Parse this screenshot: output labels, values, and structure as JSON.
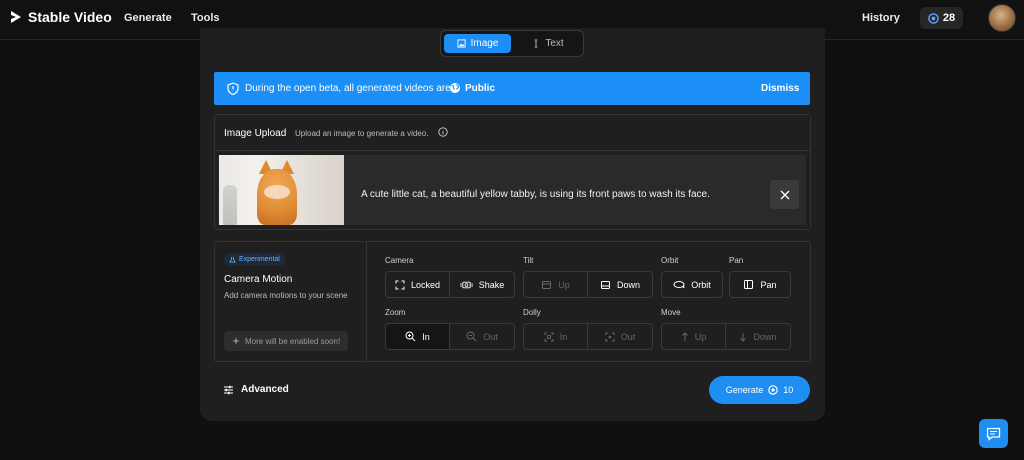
{
  "nav": {
    "brand": "Stable Video",
    "items": [
      "Generate",
      "Tools"
    ],
    "history": "History",
    "credits": "28"
  },
  "mode": {
    "image": "Image",
    "text": "Text"
  },
  "banner": {
    "text": "During the open beta, all generated videos are",
    "visibility": "Public",
    "dismiss": "Dismiss"
  },
  "upload": {
    "title": "Image Upload",
    "subtitle": "Upload an image to generate a video.",
    "caption": "A cute little cat, a beautiful yellow tabby, is using its front paws to wash its face."
  },
  "motion": {
    "badge": "Experimental",
    "title": "Camera Motion",
    "subtitle": "Add camera motions to your scene",
    "soon": "More will be enabled soon!",
    "groups": {
      "camera": {
        "label": "Camera",
        "a": "Locked",
        "b": "Shake"
      },
      "tilt": {
        "label": "Tilt",
        "a": "Up",
        "b": "Down"
      },
      "orbit": {
        "label": "Orbit",
        "a": "Orbit"
      },
      "pan": {
        "label": "Pan",
        "a": "Pan"
      },
      "zoom": {
        "label": "Zoom",
        "a": "In",
        "b": "Out"
      },
      "dolly": {
        "label": "Dolly",
        "a": "In",
        "b": "Out"
      },
      "move": {
        "label": "Move",
        "a": "Up",
        "b": "Down"
      }
    }
  },
  "footer": {
    "advanced": "Advanced",
    "generate": "Generate",
    "cost": "10"
  },
  "colors": {
    "accent": "#1e8ef3",
    "background": "#101010",
    "panel": "#1f1f1f"
  }
}
